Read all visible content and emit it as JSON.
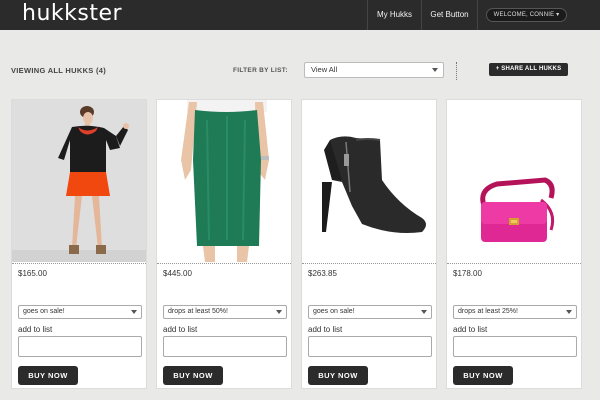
{
  "header": {
    "logo": "hukkster",
    "nav": [
      "My Hukks",
      "Get Button"
    ],
    "welcome": "WELCOME, CONNIE ▾"
  },
  "toolbar": {
    "viewing": "VIEWING ALL HUKKS (4)",
    "filter_label": "FILTER BY LIST:",
    "filter_value": "View All",
    "share_label": "+ SHARE ALL HUKKS"
  },
  "products": [
    {
      "image_icon": "model-black-sweater-orange-skirt-image",
      "price": "$165.00",
      "alert": "goes on sale!",
      "add_label": "add to list",
      "buy_label": "BUY NOW"
    },
    {
      "image_icon": "green-pencil-skirt-image",
      "price": "$445.00",
      "alert": "drops at least 50%!",
      "add_label": "add to list",
      "buy_label": "BUY NOW"
    },
    {
      "image_icon": "black-ankle-bootie-image",
      "price": "$263.85",
      "alert": "goes on sale!",
      "add_label": "add to list",
      "buy_label": "BUY NOW"
    },
    {
      "image_icon": "pink-crossbody-bag-image",
      "price": "$178.00",
      "alert": "drops at least 25%!",
      "add_label": "add to list",
      "buy_label": "BUY NOW"
    }
  ],
  "colors": {
    "header_bg": "#2b2b2b",
    "page_bg": "#e9e9e7",
    "button_bg": "#2b2b2b",
    "card_bg": "#ffffff"
  }
}
